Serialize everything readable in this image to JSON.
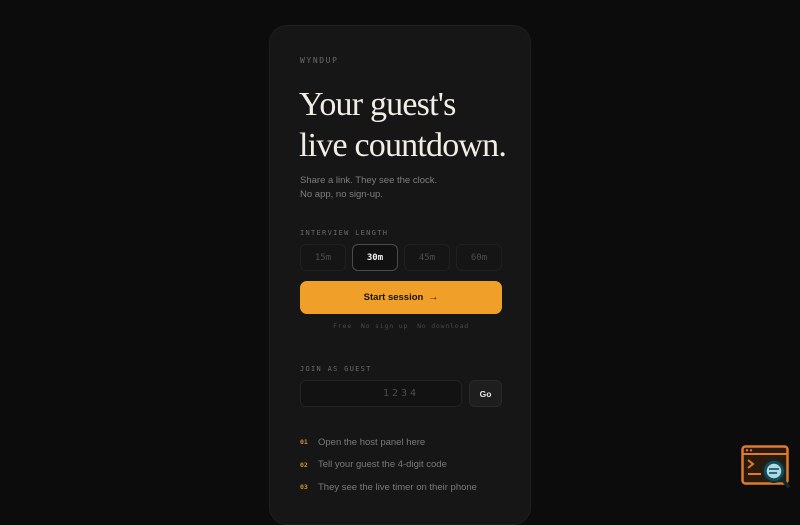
{
  "brand": "WYNDUP",
  "hero": {
    "title_line1": "Your guest's",
    "title_line2": "live countdown.",
    "subtitle_line1": "Share a link. They see the clock.",
    "subtitle_line2": "No app, no sign-up."
  },
  "interview": {
    "label": "INTERVIEW LENGTH",
    "options": [
      "15m",
      "30m",
      "45m",
      "60m"
    ],
    "selected": "30m"
  },
  "start": {
    "label": "Start session",
    "arrow": "→"
  },
  "perks": [
    "Free",
    "No sign up",
    "No download"
  ],
  "guest": {
    "label": "JOIN AS GUEST",
    "code_placeholder": "1234",
    "go_label": "Go"
  },
  "steps": [
    {
      "num": "01",
      "text": "Open the host panel here"
    },
    {
      "num": "02",
      "text": "Tell your guest the 4-digit code"
    },
    {
      "num": "03",
      "text": "They see the live timer on their phone"
    }
  ],
  "colors": {
    "background": "#0c0c0c",
    "card": "#161616",
    "accent": "#f0a028",
    "step_number": "#d4902c"
  },
  "icons": {
    "start_arrow": "arrow-right-icon",
    "corner": "terminal-search-icon"
  }
}
